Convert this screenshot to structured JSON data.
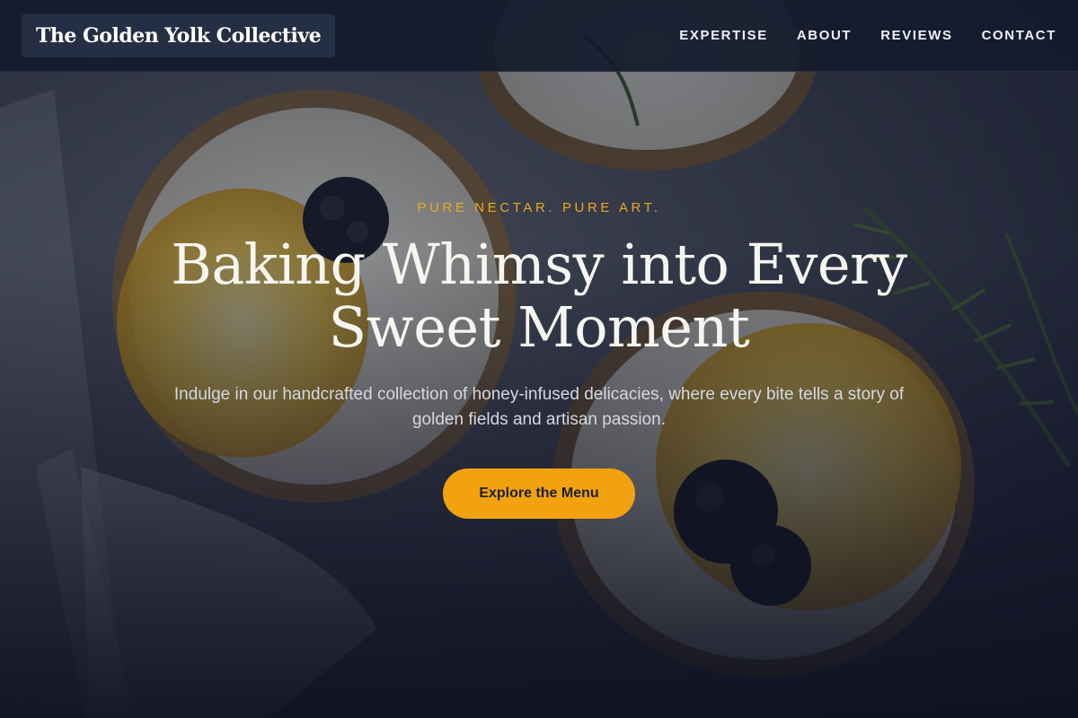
{
  "header": {
    "logo_text": "The Golden Yolk Collective",
    "nav": [
      {
        "label": "EXPERTISE"
      },
      {
        "label": "ABOUT"
      },
      {
        "label": "REVIEWS"
      },
      {
        "label": "CONTACT"
      }
    ]
  },
  "hero": {
    "tagline": "PURE NECTAR. PURE ART.",
    "headline": "Baking Whimsy into Every Sweet Moment",
    "subtitle": "Indulge in our handcrafted collection of honey-infused delicacies, where every bite tells a story of golden fields and artisan passion.",
    "cta_label": "Explore the Menu",
    "background_subject": "tart-photo-background"
  },
  "colors": {
    "accent": "#f2a20f",
    "tagline": "#e8a923",
    "header_bg": "#141b2d",
    "headline": "#f7f5ef"
  }
}
